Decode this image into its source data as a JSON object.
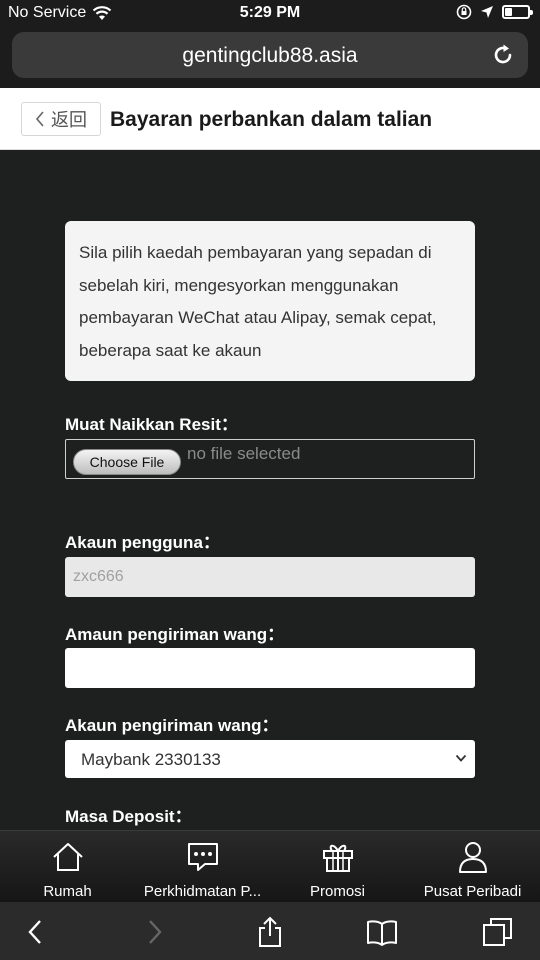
{
  "status_bar": {
    "carrier": "No Service",
    "time": "5:29 PM",
    "battery_level": 0.3
  },
  "browser": {
    "url": "gentingclub88.asia"
  },
  "header": {
    "back_label": "返回",
    "title": "Bayaran perbankan dalam talian"
  },
  "notice": {
    "text": "Sila pilih kaedah pembayaran yang sepadan di sebelah kiri, mengesyorkan menggunakan pembayaran WeChat atau Alipay, semak cepat, beberapa saat ke akaun"
  },
  "form": {
    "upload_label": "Muat Naikkan Resit：",
    "choose_file_label": "Choose File",
    "file_status": "no file selected",
    "account_label": "Akaun pengguna：",
    "account_value": "zxc666",
    "amount_label": "Amaun pengiriman wang：",
    "amount_value": "",
    "bank_label": "Akaun pengiriman wang：",
    "bank_selected": "Maybank 2330133",
    "deposit_time_label": "Masa Deposit："
  },
  "tabs": [
    {
      "label": "Rumah",
      "icon": "home-icon"
    },
    {
      "label": "Perkhidmatan P...",
      "icon": "chat-icon"
    },
    {
      "label": "Promosi",
      "icon": "gift-icon"
    },
    {
      "label": "Pusat Peribadi",
      "icon": "user-icon"
    }
  ],
  "colors": {
    "page_background": "#1e201f",
    "header_background": "#ffffff",
    "notice_background": "#f4f4f4"
  }
}
